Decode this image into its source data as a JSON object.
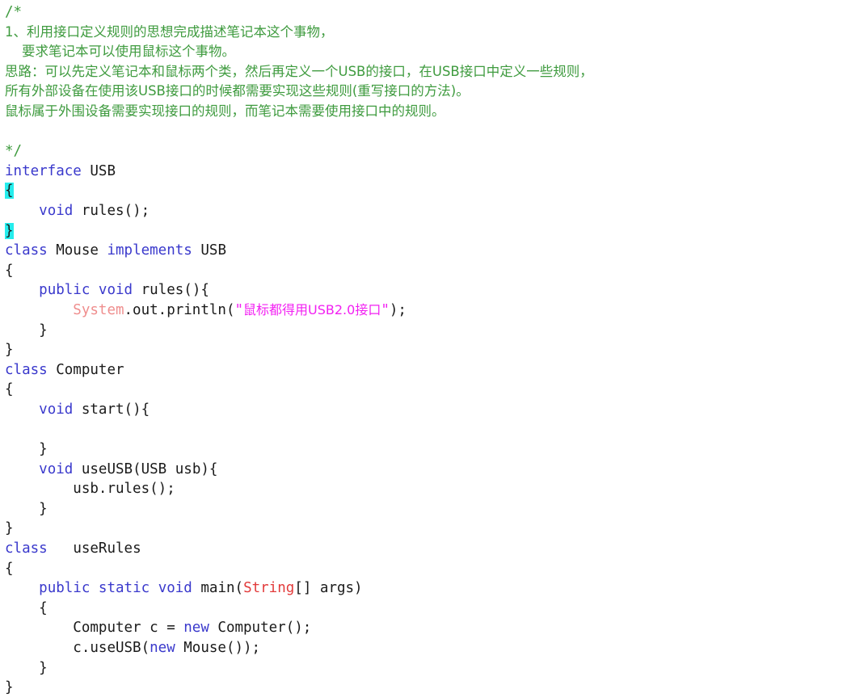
{
  "document": {
    "title": "USB interface Java example",
    "language": "java",
    "background_color": "#ffffff",
    "colors": {
      "comment": "#3f9b3f",
      "keyword": "#3a39cc",
      "type": "#e23b3b",
      "system_class": "#ef8e8e",
      "string": "#f221f2",
      "plain_text": "#1a1a1a",
      "brace_highlight": "#25eded",
      "top_rule": "#8a8a8a"
    }
  },
  "comment_block": {
    "open": "/*",
    "lines": [
      "1、利用接口定义规则的思想完成描述笔记本这个事物，",
      "    要求笔记本可以使用鼠标这个事物。",
      "思路：可以先定义笔记本和鼠标两个类，然后再定义一个USB的接口，在USB接口中定义一些规则，",
      "所有外部设备在使用该USB接口的时候都需要实现这些规则(重写接口的方法)。",
      "鼠标属于外围设备需要实现接口的规则，而笔记本需要使用接口中的规则。"
    ],
    "close": "*/"
  },
  "code": {
    "interface_usb": {
      "kw_interface": "interface",
      "name": "USB",
      "brace_open": "{",
      "brace_close": "}",
      "method": {
        "indent": "    ",
        "kw_void": "void",
        "signature": "rules();"
      }
    },
    "class_mouse": {
      "kw_class": "class",
      "name": "Mouse",
      "kw_implements": "implements",
      "implemented": "USB",
      "brace_open": "{",
      "brace_close": "}",
      "method": {
        "indent": "    ",
        "kw_public": "public",
        "kw_void": "void",
        "signature": "rules(){",
        "close": "}"
      },
      "println": {
        "indent": "        ",
        "system": "System",
        "call": ".out.println(",
        "quote_open": "\"",
        "string_text": "鼠标都得用USB2.0接口",
        "quote_close": "\"",
        "tail": ");"
      }
    },
    "class_computer": {
      "kw_class": "class",
      "name": "Computer",
      "brace_open": "{",
      "brace_close": "}",
      "method_start": {
        "indent": "    ",
        "kw_void": "void",
        "signature": "start(){",
        "close": "}"
      },
      "method_useusb": {
        "indent": "    ",
        "kw_void": "void",
        "signature": "useUSB(USB usb){",
        "body_indent": "        ",
        "body": "usb.rules();",
        "close": "}"
      }
    },
    "class_userules": {
      "kw_class": "class",
      "spacer": "  ",
      "name": "useRules",
      "brace_open": "{",
      "brace_close": "}",
      "main": {
        "indent": "    ",
        "kw_public": "public",
        "kw_static": "static",
        "kw_void": "void",
        "name": "main(",
        "type_string": "String",
        "args": "[] args)",
        "brace_open": "{",
        "brace_close": "}"
      },
      "body": {
        "indent": "        ",
        "line1_pre": "Computer c = ",
        "line1_kw_new": "new",
        "line1_post": " Computer();",
        "line2_pre": "c.useUSB(",
        "line2_kw_new": "new",
        "line2_post": " Mouse());"
      }
    }
  }
}
